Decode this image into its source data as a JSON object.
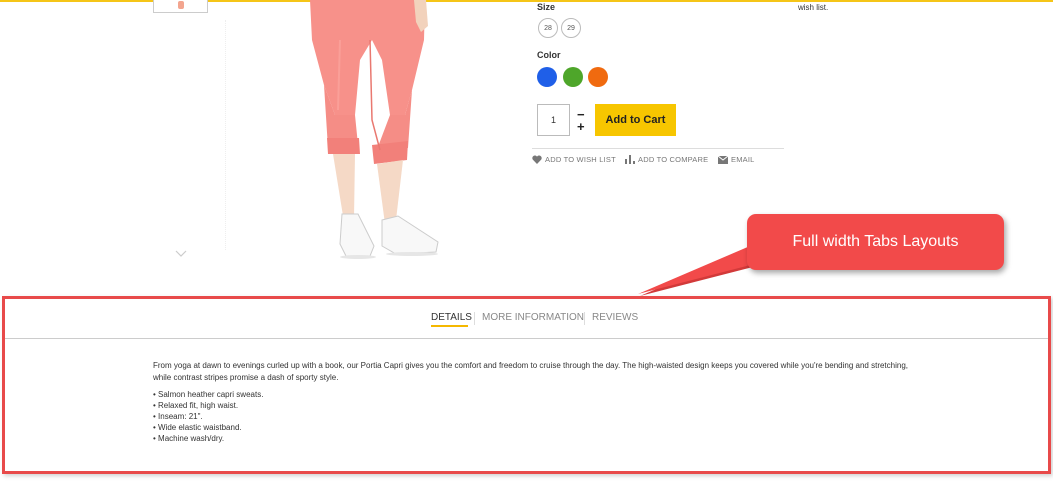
{
  "product": {
    "size_label": "Size",
    "sizes": [
      "28",
      "29"
    ],
    "color_label": "Color",
    "colors": [
      "#1f5fe8",
      "#4ea62a",
      "#f06a0f"
    ],
    "quantity": "1",
    "qty_decrease": "−",
    "qty_increase": "+",
    "add_to_cart": "Add to Cart",
    "actions": {
      "wish_list": "ADD TO WISH LIST",
      "compare": "ADD TO COMPARE",
      "email": "EMAIL"
    },
    "side_note": "wish list."
  },
  "callout": {
    "text": "Full width Tabs Layouts",
    "color": "#f24a4a"
  },
  "tabs": {
    "items": [
      "DETAILS",
      "MORE INFORMATION",
      "REVIEWS"
    ],
    "active": "DETAILS",
    "accent": "#f5b800"
  },
  "details": {
    "description": "From yoga at dawn to evenings curled up with a book, our Portia Capri gives you the comfort and freedom to cruise through the day. The high-waisted design keeps you covered while you're bending and stretching, while contrast stripes promise a dash of sporty style.",
    "bullets": [
      "• Salmon heather capri sweats.",
      "• Relaxed fit, high waist.",
      "• Inseam: 21\".",
      "• Wide elastic waistband.",
      "• Machine wash/dry."
    ]
  },
  "icons": {
    "wish": "heart-icon",
    "compare": "bar-chart-icon",
    "email": "envelope-icon",
    "thumb_nav": "chevron-down-icon"
  }
}
